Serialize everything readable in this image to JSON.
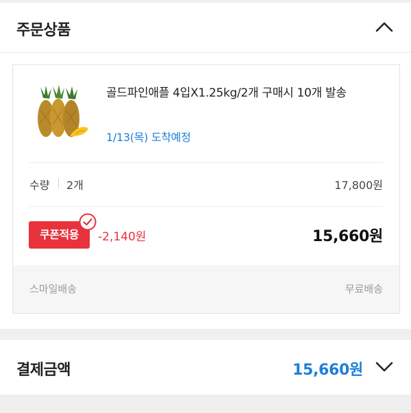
{
  "order_section": {
    "title": "주문상품",
    "collapse_icon": "chevron-up-icon"
  },
  "product": {
    "name": "골드파인애플 4입X1.25kg/2개 구매시 10개 발송",
    "delivery": "1/13(목) 도착예정",
    "image": "pineapple-product-image",
    "quantity_label": "수량",
    "quantity_value": "2개",
    "list_price": "17,800원",
    "coupon_badge": "쿠폰적용",
    "coupon_icon": "check-circle-icon",
    "discount": "-2,140원",
    "final_price": "15,660원",
    "shipping_type": "스마일배송",
    "shipping_fee": "무료배송"
  },
  "payment": {
    "title": "결제금액",
    "amount": "15,660원",
    "expand_icon": "chevron-down-icon"
  },
  "colors": {
    "accent_blue": "#1e7fd8",
    "coupon_red": "#e8323c",
    "divider": "#ececec",
    "band_gray": "#efefef"
  }
}
